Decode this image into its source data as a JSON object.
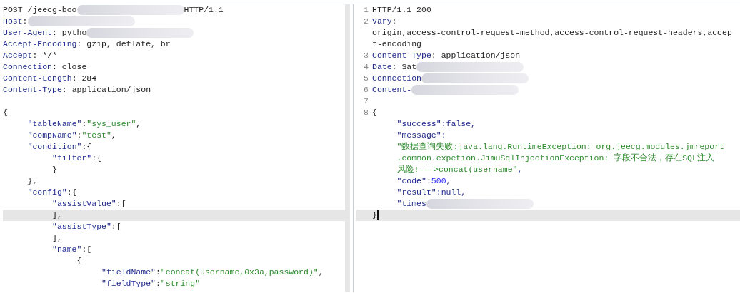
{
  "request": {
    "lines": [
      {
        "current": false,
        "segments": [
          {
            "kind": "plain",
            "text": "POST /jeecg-boo"
          },
          {
            "kind": "redacted"
          },
          {
            "kind": "plain",
            "text": "HTTP/1.1"
          }
        ]
      },
      {
        "current": false,
        "segments": [
          {
            "kind": "key",
            "text": "Host"
          },
          {
            "kind": "plain",
            "text": ":"
          },
          {
            "kind": "redacted"
          }
        ]
      },
      {
        "current": false,
        "segments": [
          {
            "kind": "key",
            "text": "User-Agent"
          },
          {
            "kind": "plain",
            "text": ": pytho"
          },
          {
            "kind": "redacted"
          }
        ]
      },
      {
        "current": false,
        "segments": [
          {
            "kind": "key",
            "text": "Accept-Encoding"
          },
          {
            "kind": "plain",
            "text": ": gzip, deflate, br"
          }
        ]
      },
      {
        "current": false,
        "segments": [
          {
            "kind": "key",
            "text": "Accept"
          },
          {
            "kind": "plain",
            "text": ": */*"
          }
        ]
      },
      {
        "current": false,
        "segments": [
          {
            "kind": "key",
            "text": "Connection"
          },
          {
            "kind": "plain",
            "text": ": close"
          }
        ]
      },
      {
        "current": false,
        "segments": [
          {
            "kind": "key",
            "text": "Content-Length"
          },
          {
            "kind": "plain",
            "text": ": 284"
          }
        ]
      },
      {
        "current": false,
        "segments": [
          {
            "kind": "key",
            "text": "Content-Type"
          },
          {
            "kind": "plain",
            "text": ": application/json"
          }
        ]
      },
      {
        "current": false
      },
      {
        "current": false,
        "segments": [
          {
            "kind": "plain",
            "text": "{"
          }
        ]
      },
      {
        "current": false,
        "segments": [
          {
            "kind": "key",
            "text": "\t\"tableName\""
          },
          {
            "kind": "plain",
            "text": ":"
          },
          {
            "kind": "str",
            "text": "\"sys_user\""
          },
          {
            "kind": "plain",
            "text": ","
          }
        ]
      },
      {
        "current": false,
        "segments": [
          {
            "kind": "key",
            "text": "\t\"compName\""
          },
          {
            "kind": "plain",
            "text": ":"
          },
          {
            "kind": "str",
            "text": "\"test\""
          },
          {
            "kind": "plain",
            "text": ","
          }
        ]
      },
      {
        "current": false,
        "segments": [
          {
            "kind": "key",
            "text": "\t\"condition\""
          },
          {
            "kind": "plain",
            "text": ":{"
          }
        ]
      },
      {
        "current": false,
        "segments": [
          {
            "kind": "key",
            "text": "\t\t\"filter\""
          },
          {
            "kind": "plain",
            "text": ":{"
          }
        ]
      },
      {
        "current": false,
        "segments": [
          {
            "kind": "plain",
            "text": "\t\t}"
          }
        ]
      },
      {
        "current": false,
        "segments": [
          {
            "kind": "plain",
            "text": "\t},"
          }
        ]
      },
      {
        "current": false,
        "segments": [
          {
            "kind": "key",
            "text": "\t\"config\""
          },
          {
            "kind": "plain",
            "text": ":{"
          }
        ]
      },
      {
        "current": false,
        "segments": [
          {
            "kind": "key",
            "text": "\t\t\"assistValue\""
          },
          {
            "kind": "plain",
            "text": ":["
          }
        ]
      },
      {
        "current": true,
        "segments": [
          {
            "kind": "plain",
            "text": "\t\t],"
          }
        ]
      },
      {
        "current": false,
        "segments": [
          {
            "kind": "key",
            "text": "\t\t\"assistType\""
          },
          {
            "kind": "plain",
            "text": ":["
          }
        ]
      },
      {
        "current": false,
        "segments": [
          {
            "kind": "plain",
            "text": "\t\t],"
          }
        ]
      },
      {
        "current": false,
        "segments": [
          {
            "kind": "key",
            "text": "\t\t\"name\""
          },
          {
            "kind": "plain",
            "text": ":["
          }
        ]
      },
      {
        "current": false,
        "segments": [
          {
            "kind": "plain",
            "text": "\t\t\t{"
          }
        ]
      },
      {
        "current": false,
        "segments": [
          {
            "kind": "key",
            "text": "\t\t\t\t\"fieldName\""
          },
          {
            "kind": "plain",
            "text": ":"
          },
          {
            "kind": "str",
            "text": "\"concat(username,0x3a,password)\""
          },
          {
            "kind": "plain",
            "text": ","
          }
        ]
      },
      {
        "current": false,
        "segments": [
          {
            "kind": "key",
            "text": "\t\t\t\t\"fieldType\""
          },
          {
            "kind": "plain",
            "text": ":"
          },
          {
            "kind": "str",
            "text": "\"string\""
          }
        ]
      }
    ]
  },
  "response": {
    "lines": [
      {
        "number": "1",
        "current": false,
        "segments": [
          {
            "kind": "plain",
            "text": "HTTP/1.1 200"
          }
        ]
      },
      {
        "number": "2",
        "current": false,
        "segments": [
          {
            "kind": "key",
            "text": "Vary"
          },
          {
            "kind": "plain",
            "text": ":"
          }
        ]
      },
      {
        "current": false,
        "segments": [
          {
            "kind": "plain",
            "text": "origin,access-control-request-method,access-control-request-headers,accep"
          }
        ]
      },
      {
        "current": false,
        "segments": [
          {
            "kind": "plain",
            "text": "t-encoding"
          }
        ]
      },
      {
        "number": "3",
        "current": false,
        "segments": [
          {
            "kind": "key",
            "text": "Content-Type"
          },
          {
            "kind": "plain",
            "text": ": application/json"
          }
        ]
      },
      {
        "number": "4",
        "current": false,
        "segments": [
          {
            "kind": "key",
            "text": "Date"
          },
          {
            "kind": "plain",
            "text": ": Sat"
          },
          {
            "kind": "redacted"
          }
        ]
      },
      {
        "number": "5",
        "current": false,
        "segments": [
          {
            "kind": "key",
            "text": "Connection"
          },
          {
            "kind": "redacted"
          }
        ]
      },
      {
        "number": "6",
        "current": false,
        "segments": [
          {
            "kind": "key",
            "text": "Content-"
          },
          {
            "kind": "redacted"
          }
        ]
      },
      {
        "number": "7",
        "current": false
      },
      {
        "number": "8",
        "current": false,
        "segments": [
          {
            "kind": "plain",
            "text": "{"
          }
        ]
      },
      {
        "current": false,
        "segments": [
          {
            "kind": "key",
            "text": "\t\"success\":false,"
          }
        ]
      },
      {
        "current": false,
        "segments": [
          {
            "kind": "key",
            "text": "\t\"message\":"
          }
        ]
      },
      {
        "current": false,
        "segments": [
          {
            "kind": "str",
            "text": "\t\"数据查询失败:java.lang.RuntimeException: org.jeecg.modules.jmreport"
          }
        ]
      },
      {
        "current": false,
        "segments": [
          {
            "kind": "str",
            "text": "\t.common.expetion.JimuSqlInjectionException: 字段不合法，存在SQL注入"
          }
        ]
      },
      {
        "current": false,
        "segments": [
          {
            "kind": "str",
            "text": "\t风险!--->concat(username\""
          },
          {
            "kind": "key",
            "text": ","
          }
        ]
      },
      {
        "current": false,
        "segments": [
          {
            "kind": "key",
            "text": "\t\"code\":"
          },
          {
            "kind": "num",
            "text": "500"
          },
          {
            "kind": "key",
            "text": ","
          }
        ]
      },
      {
        "current": false,
        "segments": [
          {
            "kind": "key",
            "text": "\t\"result\":null,"
          }
        ]
      },
      {
        "current": false,
        "segments": [
          {
            "kind": "key",
            "text": "\t\"times"
          },
          {
            "kind": "redacted"
          }
        ]
      },
      {
        "current": true,
        "cursor": true,
        "segments": [
          {
            "kind": "plain",
            "text": "}"
          }
        ]
      }
    ]
  }
}
